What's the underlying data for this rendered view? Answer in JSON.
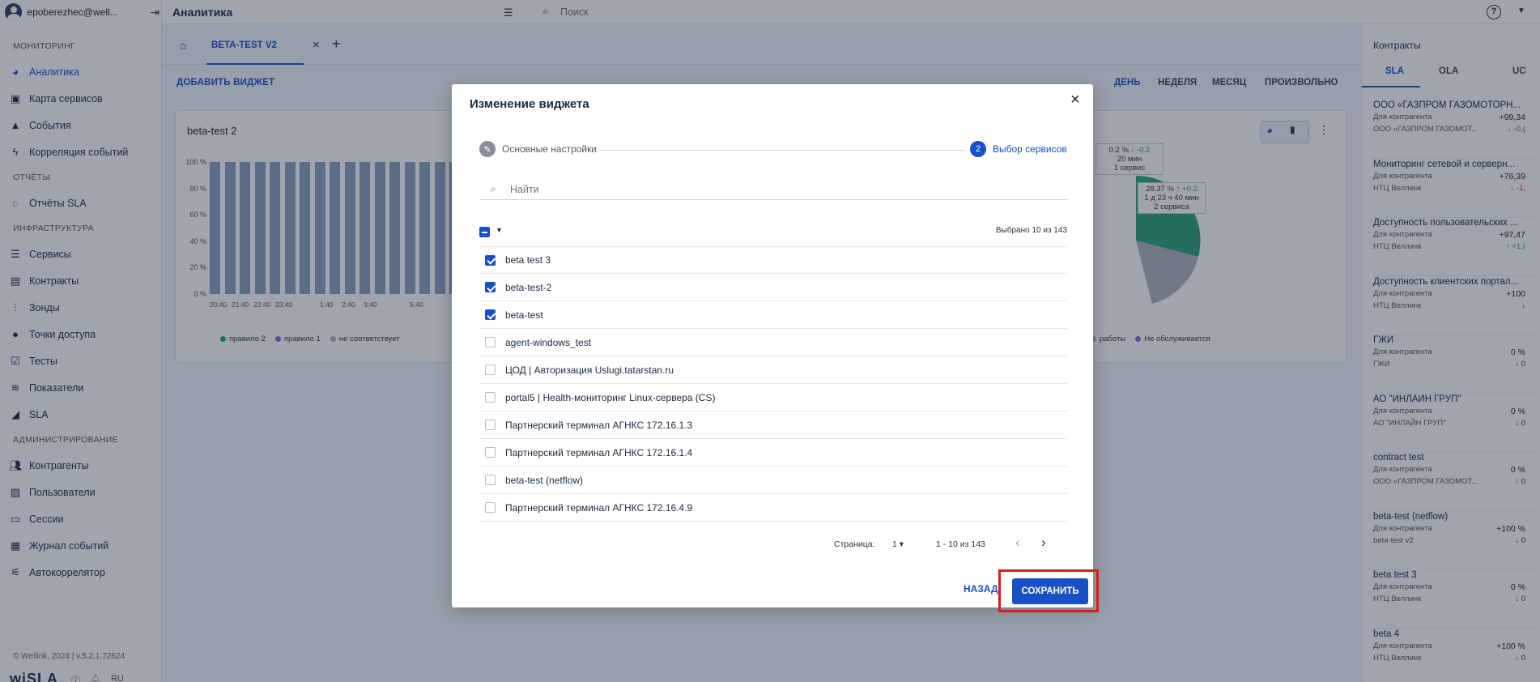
{
  "sidebar": {
    "user": "epoberezhec@well...",
    "sections": [
      {
        "title": "МОНИТОРИНГ",
        "items": [
          {
            "label": "Аналитика",
            "icon": "pie-chart-icon",
            "active": true
          },
          {
            "label": "Карта сервисов",
            "icon": "map-icon"
          },
          {
            "label": "События",
            "icon": "warning-icon"
          },
          {
            "label": "Корреляция событий",
            "icon": "bolt-icon"
          }
        ]
      },
      {
        "title": "ОТЧЁТЫ",
        "items": [
          {
            "label": "Отчёты SLA",
            "icon": "circle-arrows-icon"
          }
        ]
      },
      {
        "title": "ИНФРАСТРУКТУРА",
        "items": [
          {
            "label": "Сервисы",
            "icon": "list-icon"
          },
          {
            "label": "Контракты",
            "icon": "document-icon"
          },
          {
            "label": "Зонды",
            "icon": "waveform-icon"
          },
          {
            "label": "Точки доступа",
            "icon": "circle-icon"
          },
          {
            "label": "Тесты",
            "icon": "checklist-icon"
          },
          {
            "label": "Показатели",
            "icon": "sliders-icon"
          },
          {
            "label": "SLA",
            "icon": "signal-icon"
          }
        ]
      },
      {
        "title": "АДМИНИСТРИРОВАНИЕ",
        "items": [
          {
            "label": "Контрагенты",
            "icon": "people-icon"
          },
          {
            "label": "Пользователи",
            "icon": "user-card-icon"
          },
          {
            "label": "Сессии",
            "icon": "window-icon"
          },
          {
            "label": "Журнал событий",
            "icon": "calendar-icon"
          },
          {
            "label": "Автокоррелятор",
            "icon": "tune-icon"
          }
        ]
      }
    ],
    "footer": "© Wellink, 2024 | v.5.2.1.72624",
    "brand": "wiSLA",
    "lang": "RU"
  },
  "topbar": {
    "title": "Аналитика",
    "search_placeholder": "Поиск"
  },
  "tabs": {
    "active_tab": "BETA-TEST V2",
    "add_widget": "ДОБАВИТЬ ВИДЖЕТ",
    "periods": [
      "ДЕНЬ",
      "НЕДЕЛЯ",
      "МЕСЯЦ",
      "ПРОИЗВОЛЬНО"
    ]
  },
  "widget": {
    "title": "beta-test 2",
    "yticks": [
      "100 %",
      "80 %",
      "60 %",
      "40 %",
      "20 %",
      "0 %"
    ],
    "xticks": [
      "20:40",
      "21:40",
      "22:40",
      "23:40",
      "1:40",
      "2:40",
      "3:40",
      "5:40"
    ],
    "legend": [
      {
        "label": "правило 2",
        "color": "#2aa37a"
      },
      {
        "label": "правило 1",
        "color": "#7b6fd6"
      },
      {
        "label": "не соответствует",
        "color": "#b0b4ba"
      }
    ]
  },
  "widget2": {
    "label1": {
      "pct": "0.2 %",
      "delta": "↓ -0.2",
      "time": "20 мин",
      "services": "1 сервис"
    },
    "label2": {
      "pct": "28.37 %",
      "delta": "↑ +0.2",
      "time": "1 д 23 ч 40 мин",
      "services": "2 сервиса"
    },
    "legend": [
      {
        "label": "работы",
        "color": "#b0b4ba"
      },
      {
        "label": "Не обслуживается",
        "color": "#7b6fd6"
      }
    ]
  },
  "right_panel": {
    "title": "Контракты",
    "tabs": [
      "SLA",
      "OLA",
      "UC"
    ],
    "items": [
      {
        "name": "ООО «ГАЗПРОМ ГАЗОМОТОРН...",
        "sub1": "Для контрагента",
        "val": "+99,34",
        "sub2": "ООО «ГАЗПРОМ ГАЗОМОТ...",
        "delta": "↓ -0,("
      },
      {
        "name": "Мониторинг сетевой и серверн...",
        "sub1": "Для контрагента",
        "val": "+76,39",
        "sub2": "НТЦ Веллинк",
        "delta": "↓ -1,"
      },
      {
        "name": "Доступность пользовательских ...",
        "sub1": "Для контрагента",
        "val": "+97,47",
        "sub2": "НТЦ Веллинк",
        "delta": "↑ +1,("
      },
      {
        "name": "Доступность клиентских портал...",
        "sub1": "Для контрагента",
        "val": "+100",
        "sub2": "НТЦ Веллинк",
        "delta": "↓"
      },
      {
        "name": "ГЖИ",
        "sub1": "Для контрагента",
        "val": "0 %",
        "sub2": "ГЖИ",
        "delta": "↓ 0"
      },
      {
        "name": "АО \"ИНЛАЙН ГРУП\"",
        "sub1": "Для контрагента",
        "val": "0 %",
        "sub2": "АО \"ИНЛАЙН ГРУП\"",
        "delta": "↓ 0"
      },
      {
        "name": "contract test",
        "sub1": "Для контрагента",
        "val": "0 %",
        "sub2": "ООО «ГАЗПРОМ ГАЗОМОТ...",
        "delta": "↓ 0"
      },
      {
        "name": "beta-test (netflow)",
        "sub1": "Для контрагента",
        "val": "+100 %",
        "sub2": "beta-test v2",
        "delta": "↓ 0"
      },
      {
        "name": "beta test 3",
        "sub1": "Для контрагента",
        "val": "0 %",
        "sub2": "НТЦ Веллинк",
        "delta": "↓ 0"
      },
      {
        "name": "beta 4",
        "sub1": "Для контрагента",
        "val": "+100 %",
        "sub2": "НТЦ Веллинк",
        "delta": "↓ 0"
      }
    ]
  },
  "modal": {
    "title": "Изменение виджета",
    "steps": [
      {
        "label": "Основные настройки",
        "num": "✎"
      },
      {
        "label": "Выбор сервисов",
        "num": "2"
      }
    ],
    "search_placeholder": "Найти",
    "selected_count": "Выбрано 10 из 143",
    "rows": [
      {
        "label": "beta test 3",
        "checked": true
      },
      {
        "label": "beta-test-2",
        "checked": true
      },
      {
        "label": "beta-test",
        "checked": true
      },
      {
        "label": "agent-windows_test",
        "checked": false
      },
      {
        "label": "ЦОД | Авторизация Uslugi.tatarstan.ru",
        "checked": false
      },
      {
        "label": "portal5 | Health-мониторинг Linux-сервера (CS)",
        "checked": false
      },
      {
        "label": "Партнерский терминал АГНКС 172.16.1.3",
        "checked": false
      },
      {
        "label": "Партнерский терминал АГНКС 172.16.1.4",
        "checked": false
      },
      {
        "label": "beta-test (netflow)",
        "checked": false
      },
      {
        "label": "Партнерский терминал АГНКС 172.16.4.9",
        "checked": false
      }
    ],
    "pager": {
      "label": "Страница:",
      "page": "1",
      "range": "1 - 10 из 143"
    },
    "back_label": "НАЗАД",
    "save_label": "СОХРАНИТЬ"
  }
}
